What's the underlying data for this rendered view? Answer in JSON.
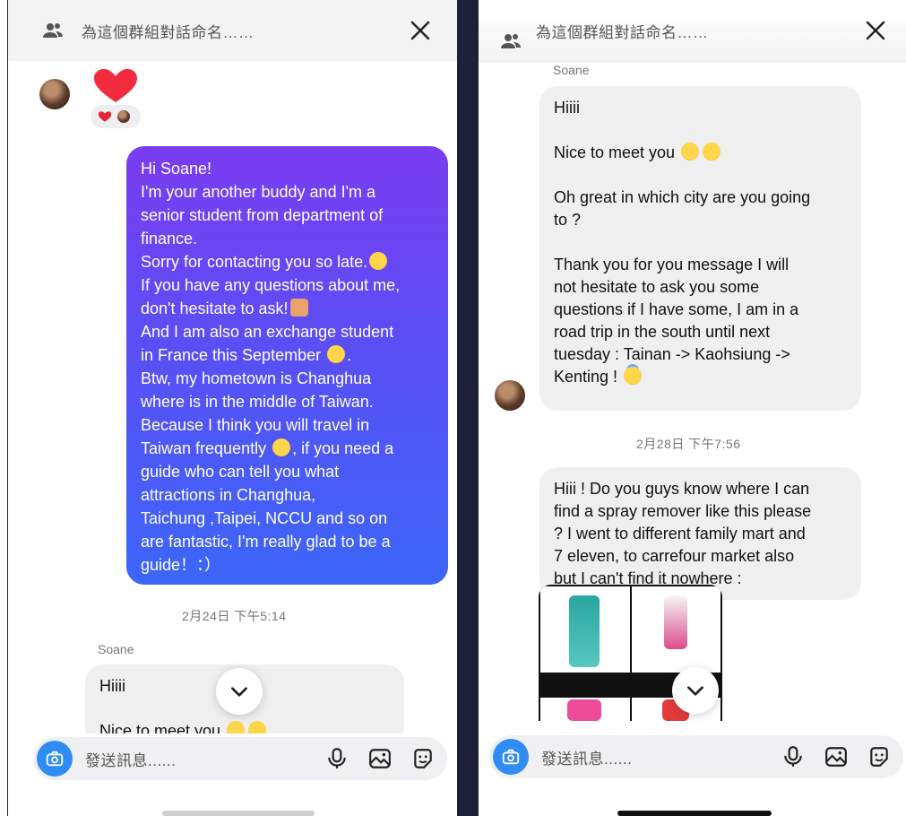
{
  "left": {
    "header": {
      "title": "為這個群組對話命名……"
    },
    "sent_message": {
      "lines": [
        "Hi Soane!",
        "I'm your another buddy and I'm a",
        "senior student from department of",
        "finance.",
        "Sorry for contacting you so late.",
        "If you have any questions about me,",
        "don't hesitate to ask!",
        "And I am also an exchange student",
        "in France this September",
        "Btw, my hometown is Changhua",
        "where is in the middle of Taiwan.",
        "Because I think you will travel in",
        "Taiwan frequently",
        "guide who can tell you what",
        "attractions in Changhua,",
        "Taichung ,Taipei, NCCU and so on",
        "are fantastic, I'm really glad to be a",
        "guide！：）"
      ],
      "line_suffix_13": ", if you need a"
    },
    "timestamp": "2月24日 下午5:14",
    "sender": "Soane",
    "recv_preview": {
      "line1": "Hiiii",
      "line2": "Nice to meet you"
    },
    "composer": {
      "placeholder": "發送訊息......"
    }
  },
  "right": {
    "header": {
      "title": "為這個群組對話命名……"
    },
    "sender": "Soane",
    "message1": {
      "p1": "Hiiii",
      "p2": "Nice to meet you",
      "p3_lines": [
        "Oh great in which city are you going",
        "to ?"
      ],
      "p4_lines": [
        "Thank you for you message I will",
        "not hesitate to ask you some",
        "questions if I have some, I am in a",
        "road trip in the south until next",
        "tuesday : Tainan -> Kaohsiung ->",
        "Kenting !"
      ]
    },
    "timestamp": "2月28日 下午7:56",
    "message2": {
      "lines": [
        "Hiii ! Do you guys know where I can",
        "find a spray remover like this please",
        "? I went to different family mart and",
        "7 eleven, to carrefour market also",
        "but I can't find it nowhere :"
      ]
    },
    "composer": {
      "placeholder": "發送訊息......"
    }
  },
  "colors": {
    "accent": "#2f8cf5",
    "sent_gradient_top": "#7a3cf0",
    "sent_gradient_bottom": "#3c66f8",
    "heart": "#f22b3e",
    "received_bubble": "#efeff0"
  },
  "icons": [
    "group-icon",
    "close-icon",
    "heart-icon",
    "camera-icon",
    "microphone-icon",
    "image-icon",
    "sticker-icon",
    "chevron-down-icon"
  ]
}
